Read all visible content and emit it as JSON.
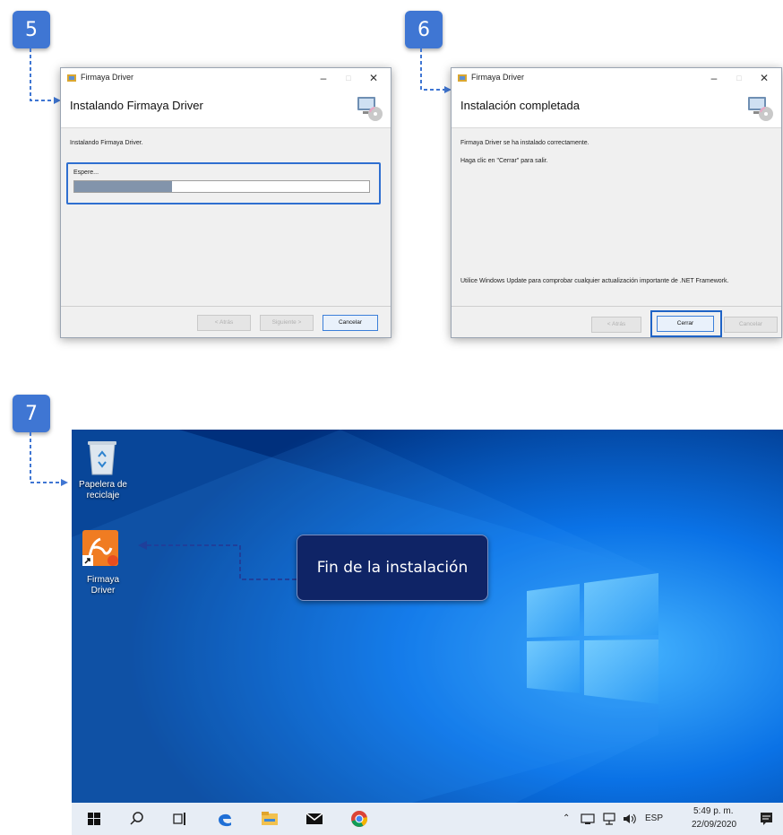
{
  "steps": {
    "five": "5",
    "six": "6",
    "seven": "7"
  },
  "installer_progress": {
    "window_title": "Firmaya Driver",
    "header_title": "Instalando Firmaya Driver",
    "status_text": "Instalando Firmaya Driver.",
    "wait_label": "Espere...",
    "progress_fraction": 0.33,
    "buttons": {
      "back": "< Atrás",
      "next": "Siguiente >",
      "cancel": "Cancelar"
    }
  },
  "installer_complete": {
    "window_title": "Firmaya Driver",
    "header_title": "Instalación completada",
    "line1": "Firmaya Driver se ha instalado correctamente.",
    "line2": "Haga clic en \"Cerrar\" para salir.",
    "update_note": "Utilice Windows Update para comprobar cualquier actualización importante de .NET Framework.",
    "buttons": {
      "back": "< Atrás",
      "close": "Cerrar",
      "cancel": "Cancelar"
    }
  },
  "desktop": {
    "recycle_bin_label_1": "Papelera de",
    "recycle_bin_label_2": "reciclaje",
    "app_label_1": "Firmaya",
    "app_label_2": "Driver",
    "callout": "Fin de la instalación"
  },
  "taskbar": {
    "language": "ESP",
    "time": "5:49 p. m.",
    "date": "22/09/2020"
  },
  "colors": {
    "badge": "#3f76d3",
    "highlight": "#1f63c6",
    "callout_bg": "#0f2466",
    "desktop_blue": "#0a5fd6"
  }
}
